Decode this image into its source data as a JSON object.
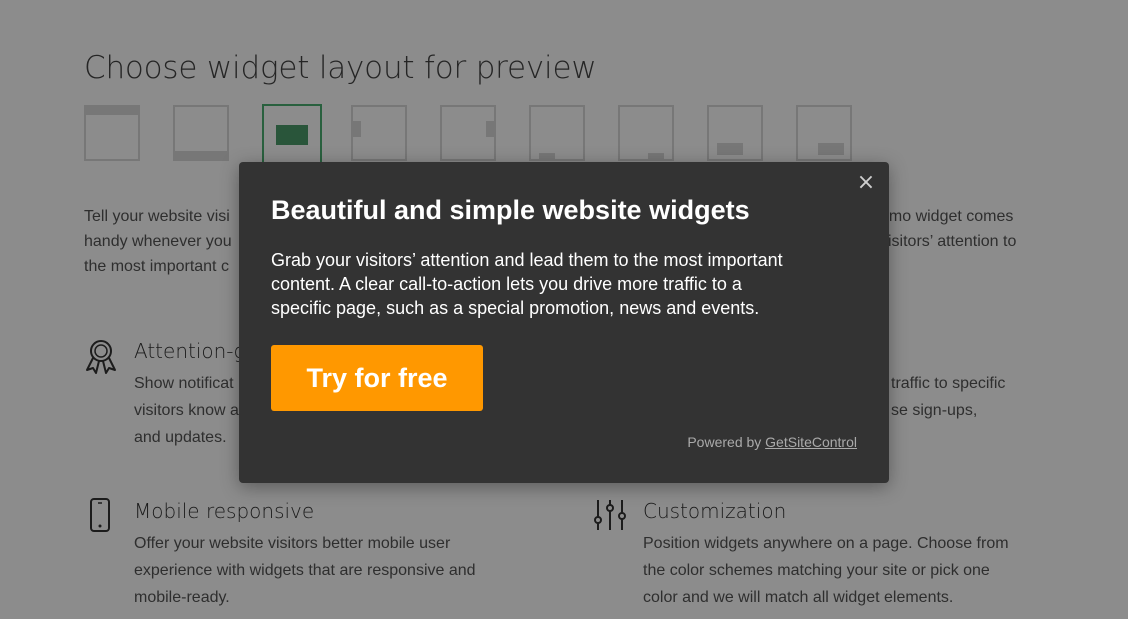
{
  "page": {
    "title": "Choose widget layout for preview",
    "layouts": [
      {
        "name": "top-bar"
      },
      {
        "name": "bottom-bar"
      },
      {
        "name": "center-popup",
        "selected": true
      },
      {
        "name": "left-panel"
      },
      {
        "name": "right-panel"
      },
      {
        "name": "bottom-left"
      },
      {
        "name": "bottom-right"
      },
      {
        "name": "top-center"
      },
      {
        "name": "middle-right"
      }
    ],
    "intro": {
      "left_lines": [
        "Tell your website visi",
        "handy whenever you",
        "the most important c"
      ],
      "right_lines": [
        "omo widget comes",
        "visitors’ attention to",
        "."
      ]
    },
    "features": [
      {
        "title": "Attention-g",
        "icon": "award-ribbon-icon",
        "lines": [
          "Show notificat",
          "visitors know a",
          "and updates."
        ]
      },
      {
        "title": "",
        "icon": "",
        "lines": [
          "traffic to specific",
          "se sign-ups,",
          ""
        ]
      },
      {
        "title": "Mobile responsive",
        "icon": "mobile-phone-icon",
        "lines": [
          "Offer your website visitors better mobile user",
          "experience with widgets that are responsive and",
          "mobile-ready."
        ]
      },
      {
        "title": "Customization",
        "icon": "sliders-icon",
        "lines": [
          "Position widgets anywhere on a page. Choose from",
          "the color schemes matching your site or pick one",
          "color and we will match all widget elements."
        ]
      }
    ]
  },
  "modal": {
    "close_icon": "close-icon",
    "close_symbol": "×",
    "title": "Beautiful and simple website widgets",
    "text_lines": [
      "Grab your visitors’ attention and lead them to the most important",
      "content. A clear call-to-action lets you drive more traffic to a",
      "specific page, such as a special promotion, news and events."
    ],
    "cta_label": "Try for free",
    "powered_prefix": "Powered by ",
    "powered_link": "GetSiteControl"
  },
  "colors": {
    "modal_bg": "#333333",
    "cta": "#ff9800",
    "selected_layout": "#4c9b6b",
    "overlay": "rgba(0,0,0,0.45)"
  }
}
